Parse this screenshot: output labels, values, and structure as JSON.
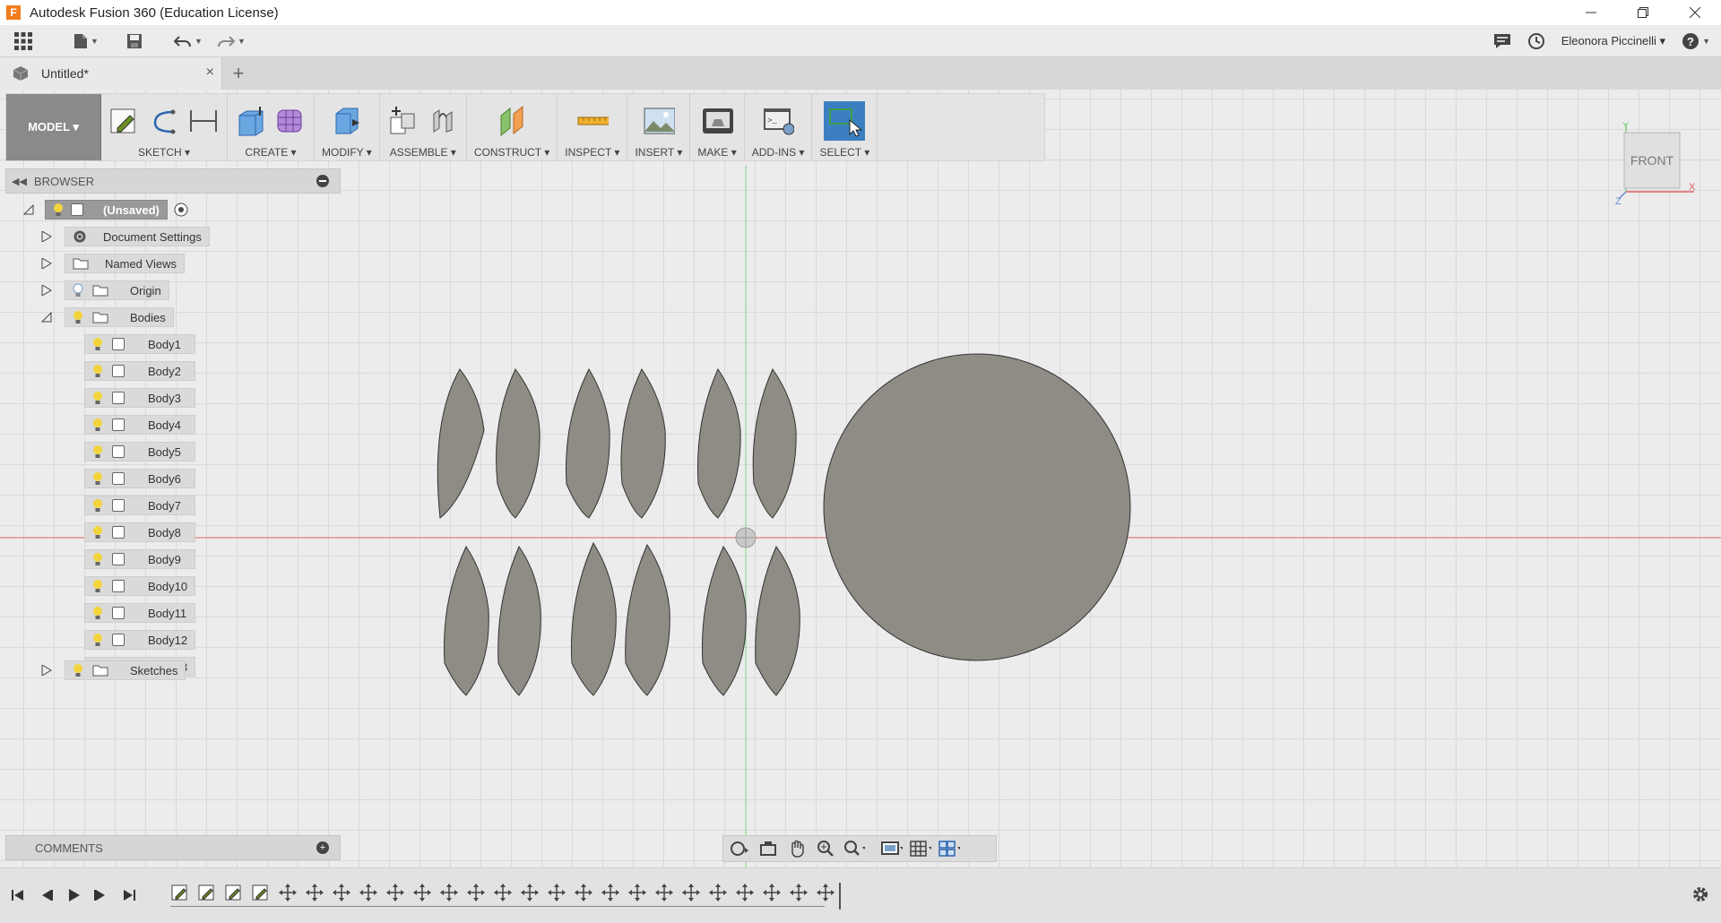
{
  "window": {
    "title": "Autodesk Fusion 360 (Education License)",
    "logo_letter": "F"
  },
  "qat": {
    "user": "Eleonora Piccinelli ▾"
  },
  "tabbar": {
    "doc_title": "Untitled*",
    "close": "×",
    "new_tab": "+"
  },
  "ribbon": {
    "workspace": "MODEL ▾",
    "groups": [
      "SKETCH ▾",
      "CREATE ▾",
      "MODIFY ▾",
      "ASSEMBLE ▾",
      "CONSTRUCT ▾",
      "INSPECT ▾",
      "INSERT ▾",
      "MAKE ▾",
      "ADD-INS ▾",
      "SELECT ▾"
    ]
  },
  "browser": {
    "title": "BROWSER",
    "root": "(Unsaved)",
    "items": [
      "Document Settings",
      "Named Views",
      "Origin",
      "Bodies"
    ],
    "bodies": [
      "Body1",
      "Body2",
      "Body3",
      "Body4",
      "Body5",
      "Body6",
      "Body7",
      "Body8",
      "Body9",
      "Body10",
      "Body11",
      "Body12",
      "Body13"
    ],
    "sketches": "Sketches"
  },
  "viewcube": {
    "face": "FRONT",
    "axis_x": "X",
    "axis_y": "Y",
    "axis_z": "Z"
  },
  "comments": {
    "title": "COMMENTS"
  },
  "colors": {
    "accent": "#3c7fc0",
    "body_fill": "#8e8c84",
    "x_axis": "#e06060",
    "y_axis": "#7fd07f"
  },
  "timeline": {
    "feature_count": 25
  }
}
